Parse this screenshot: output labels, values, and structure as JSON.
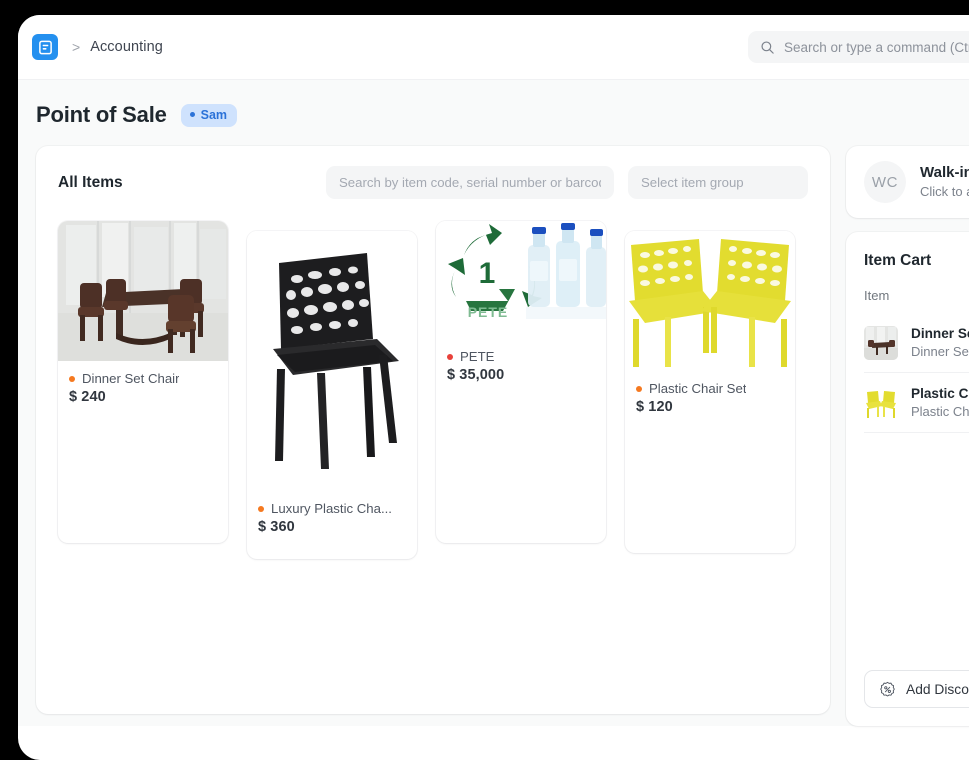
{
  "navbar": {
    "logo_icon": "erpnext-logo-icon",
    "breadcrumb_separator": ">",
    "breadcrumb_item": "Accounting",
    "search_icon": "search-icon",
    "search_placeholder": "Search or type a command (Ctrl + G)",
    "search_value": "Search or type a command (Ctrl + G)"
  },
  "page": {
    "title": "Point of Sale",
    "status_label": "Sam",
    "status_color": "#2b72d8",
    "status_bg": "#cfe2fd"
  },
  "items_panel": {
    "title": "All Items",
    "search_placeholder": "Search by item code, serial number or barcode",
    "search_value": "",
    "group_placeholder": "Select item group",
    "group_value": "",
    "items": [
      {
        "name": "Dinner Set Chair",
        "price": "$ 240",
        "dot_color": "#f57920",
        "image": "dining-set-photo"
      },
      {
        "name": "Luxury Plastic Cha...",
        "price": "$ 360",
        "dot_color": "#f57920",
        "image": "black-mesh-chair-photo"
      },
      {
        "name": "PETE",
        "price": "$ 35,000",
        "dot_color": "#e8413a",
        "image": "pete-recycling-bottles-photo"
      },
      {
        "name": "Plastic Chair Set",
        "price": "$ 120",
        "dot_color": "#f57920",
        "image": "yellow-chair-set-photo"
      }
    ]
  },
  "customer": {
    "initials": "WC",
    "name": "Walk-in Customer",
    "subtitle": "Click to add customer"
  },
  "cart": {
    "title": "Item Cart",
    "column_item": "Item",
    "rows": [
      {
        "name": "Dinner Set Chair",
        "code": "Dinner Set Chair",
        "image": "dining-set-thumb"
      },
      {
        "name": "Plastic Chair Set",
        "code": "Plastic Chair Set",
        "image": "yellow-chair-thumb"
      }
    ],
    "discount_label": "Add Discount",
    "discount_icon": "percent-badge-icon"
  }
}
